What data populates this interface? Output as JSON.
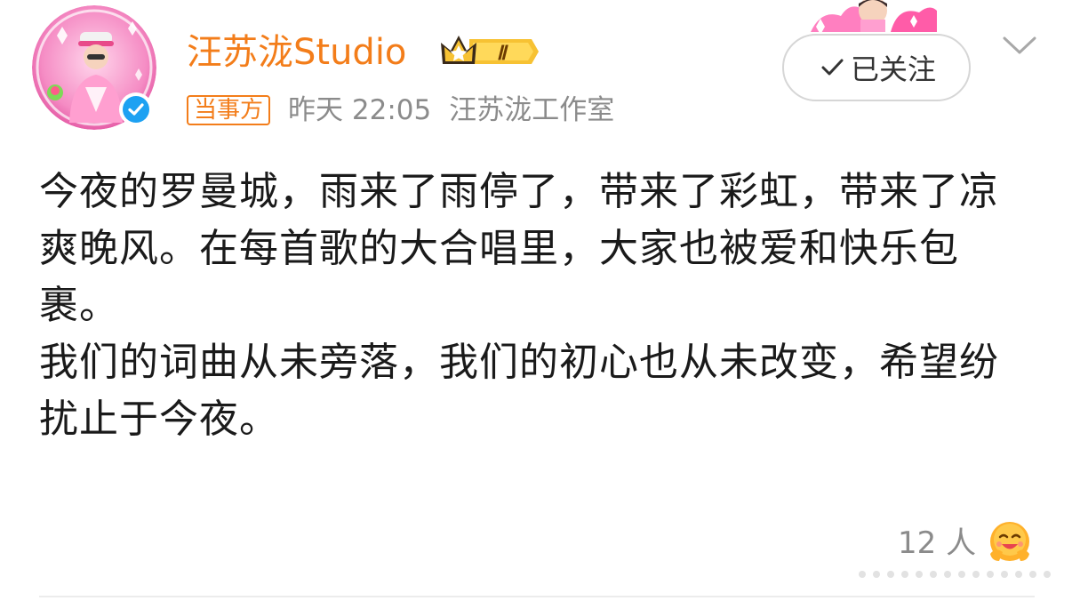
{
  "header": {
    "user_name": "汪苏泷Studio",
    "party_tag": "当事方",
    "time": "昨天 22:05",
    "source": "汪苏泷工作室",
    "follow_label": "已关注",
    "badge_level": "Ⅱ"
  },
  "post": {
    "paragraph_1": "今夜的罗曼城，雨来了雨停了，带来了彩虹，带来了凉爽晚风。在每首歌的大合唱里，大家也被爱和快乐包裹。",
    "paragraph_2": "我们的词曲从未旁落，我们的初心也从未改变，希望纷扰止于今夜。"
  },
  "reactions": {
    "like_count": "12 人"
  },
  "icons": {
    "verified": "verified-check-icon",
    "crown": "crown-badge-icon",
    "follow": "check-icon",
    "more": "chevron-down-icon",
    "like_emoji": "hug-face-emoji-icon"
  },
  "colors": {
    "brand_orange": "#f37d1a",
    "verified_blue": "#1da1f2",
    "meta_gray": "#8b8b8b",
    "text": "#1a1a1a"
  }
}
